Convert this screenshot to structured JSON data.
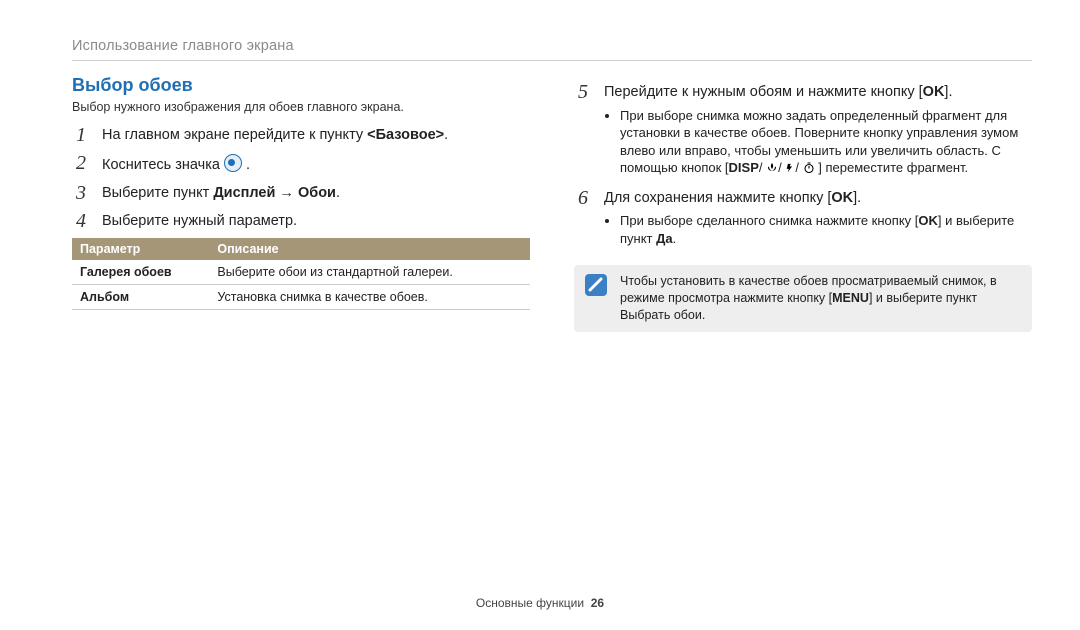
{
  "header": {
    "breadcrumb": "Использование главного экрана"
  },
  "left": {
    "heading": "Выбор обоев",
    "sub": "Выбор нужного изображения для обоев главного экрана.",
    "steps": {
      "s1_a": "На главном экране перейдите к пункту ",
      "s1_b": "<Базовое>",
      "s1_c": ".",
      "s2_a": "Коснитесь значка ",
      "s2_b": " .",
      "s3_a": "Выберите пункт ",
      "s3_b": "Дисплей",
      "s3_arrow": " → ",
      "s3_c": "Обои",
      "s3_d": ".",
      "s4": "Выберите нужный параметр."
    },
    "table": {
      "h1": "Параметр",
      "h2": "Описание",
      "r1k": "Галерея обоев",
      "r1v": "Выберите обои из стандартной галереи.",
      "r2k": "Альбом",
      "r2v": "Установка снимка в качестве обоев."
    }
  },
  "right": {
    "s5_a": "Перейдите к нужным обоям и нажмите кнопку [",
    "s5_ok": "OK",
    "s5_b": "].",
    "b5_1a": "При выборе снимка можно задать определенный фрагмент для установки в качестве обоев. Поверните кнопку управления зумом   влево или вправо, чтобы уменьшить или увеличить область. С помощью кнопок [",
    "b5_disp": "DISP",
    "b5_sep": "/",
    "b5_1b": "] переместите фрагмент.",
    "s6_a": "Для сохранения нажмите кнопку [",
    "s6_ok": "OK",
    "s6_b": "].",
    "b6_1a": "При выборе сделанного снимка нажмите кнопку [",
    "b6_ok": "OK",
    "b6_1b": "] и выберите пункт ",
    "b6_da": "Да",
    "b6_1c": ".",
    "note_a": "Чтобы установить в качестве обоев просматриваемый снимок, в режиме просмотра нажмите кнопку [",
    "note_menu": "MENU",
    "note_b": "] и выберите пункт ",
    "note_bold": "Выбрать обои",
    "note_c": "."
  },
  "footer": {
    "label": "Основные функции",
    "page": "26"
  },
  "nums": {
    "n1": "1",
    "n2": "2",
    "n3": "3",
    "n4": "4",
    "n5": "5",
    "n6": "6"
  }
}
